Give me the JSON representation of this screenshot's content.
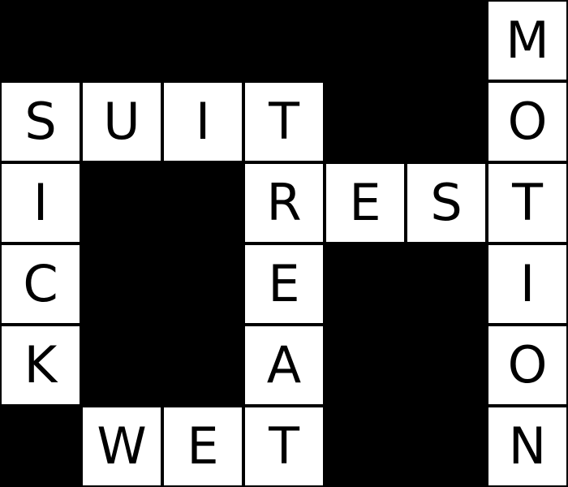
{
  "puzzle": {
    "colors": {
      "block": "#000000",
      "cell": "#ffffff",
      "letter": "#000000"
    },
    "grid": [
      [
        "#",
        "#",
        "#",
        "#",
        "#",
        "#",
        "M"
      ],
      [
        "S",
        "U",
        "I",
        "T",
        "#",
        "#",
        "O"
      ],
      [
        "I",
        "#",
        "#",
        "R",
        "E",
        "S",
        "T"
      ],
      [
        "C",
        "#",
        "#",
        "E",
        "#",
        "#",
        "I"
      ],
      [
        "K",
        "#",
        "#",
        "A",
        "#",
        "#",
        "O"
      ],
      [
        "#",
        "W",
        "E",
        "T",
        "#",
        "#",
        "N"
      ]
    ]
  }
}
